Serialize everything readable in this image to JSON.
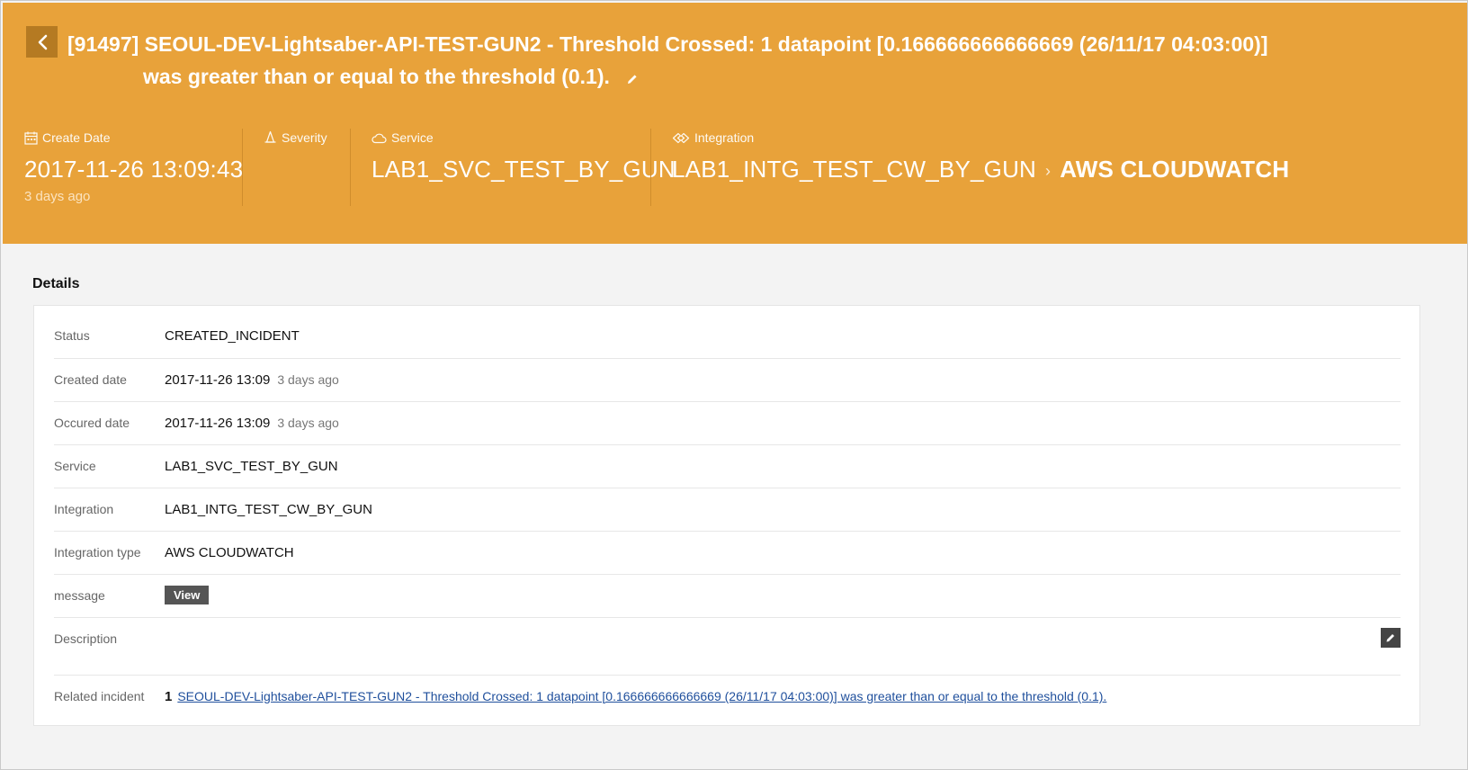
{
  "header": {
    "title_line1": "[91497] SEOUL-DEV-Lightsaber-API-TEST-GUN2 - Threshold Crossed: 1 datapoint [0.166666666666669 (26/11/17 04:03:00)]",
    "title_line2": "was greater than or equal to the threshold (0.1).",
    "create_date": {
      "label": "Create Date",
      "value": "2017-11-26 13:09:43",
      "ago": "3 days ago"
    },
    "severity": {
      "label": "Severity"
    },
    "service": {
      "label": "Service",
      "value": "LAB1_SVC_TEST_BY_GUN"
    },
    "integration": {
      "label": "Integration",
      "name": "LAB1_INTG_TEST_CW_BY_GUN",
      "type": "AWS CLOUDWATCH"
    }
  },
  "details": {
    "title": "Details",
    "status": {
      "label": "Status",
      "value": "CREATED_INCIDENT"
    },
    "created": {
      "label": "Created date",
      "value": "2017-11-26 13:09",
      "ago": "3 days ago"
    },
    "occured": {
      "label": "Occured date",
      "value": "2017-11-26 13:09",
      "ago": "3 days ago"
    },
    "service": {
      "label": "Service",
      "value": "LAB1_SVC_TEST_BY_GUN"
    },
    "integration": {
      "label": "Integration",
      "value": "LAB1_INTG_TEST_CW_BY_GUN"
    },
    "integration_type": {
      "label": "Integration type",
      "value": "AWS CLOUDWATCH"
    },
    "message": {
      "label": "message",
      "button": "View"
    },
    "description": {
      "label": "Description"
    },
    "related": {
      "label": "Related incident",
      "count": "1",
      "link": "SEOUL-DEV-Lightsaber-API-TEST-GUN2 - Threshold Crossed: 1 datapoint [0.166666666666669 (26/11/17 04:03:00)] was greater than or equal to the threshold (0.1)."
    }
  },
  "colors": {
    "header_bg": "#e8a23a",
    "back_btn": "#b57a22",
    "link": "#1f4f9c"
  },
  "icons": [
    "back-icon",
    "pencil-icon",
    "calendar-icon",
    "bell-icon",
    "cloud-icon",
    "integration-icon",
    "chevron-right-icon"
  ]
}
